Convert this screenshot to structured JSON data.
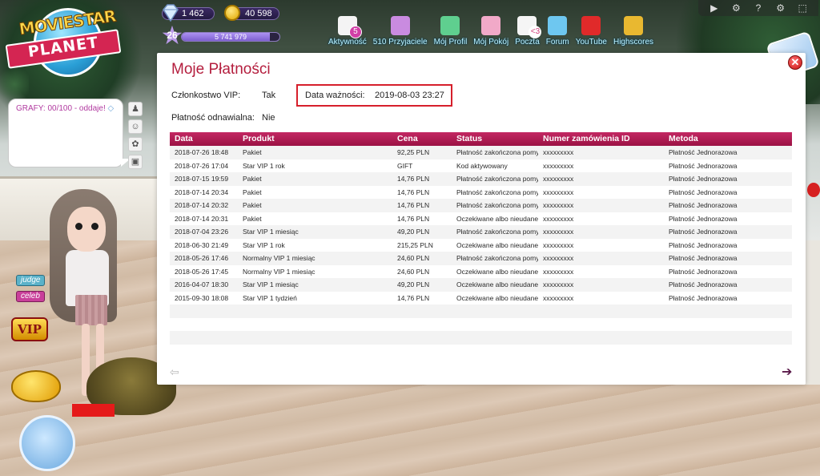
{
  "hud": {
    "diamonds": "1 462",
    "coins": "40 598",
    "level": "26",
    "xp": "5 741 979",
    "xp_progress": 0.9
  },
  "logo": {
    "line1": "MOVIESTAR",
    "line2": "PLANET"
  },
  "nav": [
    {
      "label": "Aktywność",
      "icon": "activity-icon",
      "color": "#f4f4f4",
      "badge": "5"
    },
    {
      "label": "510 Przyjaciele",
      "icon": "friends-icon",
      "color": "#c98be0"
    },
    {
      "label": "Mój Profil",
      "icon": "profile-icon",
      "color": "#5fcf8f"
    },
    {
      "label": "Mój Pokój",
      "icon": "room-icon",
      "color": "#f1a9c8"
    },
    {
      "label": "Poczta",
      "icon": "mail-icon",
      "color": "#f5f5f5",
      "badge_text": "<3"
    },
    {
      "label": "Forum",
      "icon": "forum-icon",
      "color": "#6ec7f0"
    },
    {
      "label": "YouTube",
      "icon": "youtube-icon",
      "color": "#e02a2a"
    },
    {
      "label": "Highscores",
      "icon": "trophy-icon",
      "color": "#e9b830"
    }
  ],
  "topright": [
    "▶",
    "⚙",
    "?",
    "⚙",
    "⬚"
  ],
  "chat": {
    "text": "GRAFY: 00/100 - oddaje!"
  },
  "tags": {
    "judge": "judge",
    "celeb": "celeb",
    "vip": "VIP"
  },
  "dialog": {
    "title": "Moje Płatności",
    "vip_label": "Członkostwo VIP:",
    "vip_value": "Tak",
    "expiry_label": "Data ważności:",
    "expiry_value": "2019-08-03 23:27",
    "renew_label": "Płatność odnawialna:",
    "renew_value": "Nie"
  },
  "table": {
    "headers": [
      "Data",
      "Produkt",
      "Cena",
      "Status",
      "Numer zamówienia ID",
      "Metoda"
    ],
    "rows": [
      [
        "2018-07-26 18:48",
        "Pakiet",
        "92,25 PLN",
        "Płatność zakończona pomyślnie",
        "xxxxxxxxx",
        "Płatność Jednorazowa"
      ],
      [
        "2018-07-26 17:04",
        "Star VIP 1 rok",
        "GIFT",
        "Kod aktywowany",
        "xxxxxxxxx",
        "Płatność Jednorazowa"
      ],
      [
        "2018-07-15 19:59",
        "Pakiet",
        "14,76 PLN",
        "Płatność zakończona pomyślnie",
        "xxxxxxxxx",
        "Płatność Jednorazowa"
      ],
      [
        "2018-07-14 20:34",
        "Pakiet",
        "14,76 PLN",
        "Płatność zakończona pomyślnie",
        "xxxxxxxxx",
        "Płatność Jednorazowa"
      ],
      [
        "2018-07-14 20:32",
        "Pakiet",
        "14,76 PLN",
        "Płatność zakończona pomyślnie",
        "xxxxxxxxx",
        "Płatność Jednorazowa"
      ],
      [
        "2018-07-14 20:31",
        "Pakiet",
        "14,76 PLN",
        "Oczekiwane albo nieudane",
        "xxxxxxxxx",
        "Płatność Jednorazowa"
      ],
      [
        "2018-07-04 23:26",
        "Star VIP 1 miesiąc",
        "49,20 PLN",
        "Płatność zakończona pomyślnie",
        "xxxxxxxxx",
        "Płatność Jednorazowa"
      ],
      [
        "2018-06-30 21:49",
        "Star VIP 1 rok",
        "215,25 PLN",
        "Oczekiwane albo nieudane",
        "xxxxxxxxx",
        "Płatność Jednorazowa"
      ],
      [
        "2018-05-26 17:46",
        "Normalny VIP 1 miesiąc",
        "24,60 PLN",
        "Płatność zakończona pomyślnie",
        "xxxxxxxxx",
        "Płatność Jednorazowa"
      ],
      [
        "2018-05-26 17:45",
        "Normalny VIP 1 miesiąc",
        "24,60 PLN",
        "Oczekiwane albo nieudane",
        "xxxxxxxxx",
        "Płatność Jednorazowa"
      ],
      [
        "2016-04-07 18:30",
        "Star VIP 1 miesiąc",
        "49,20 PLN",
        "Oczekiwane albo nieudane",
        "xxxxxxxxx",
        "Płatność Jednorazowa"
      ],
      [
        "2015-09-30 18:08",
        "Star VIP 1 tydzień",
        "14,76 PLN",
        "Oczekiwane albo nieudane",
        "xxxxxxxxx",
        "Płatność Jednorazowa"
      ]
    ],
    "empty_rows": 3
  },
  "pager": {
    "prev": "⇦",
    "next": "➔"
  },
  "colors": {
    "accent": "#b41e3e",
    "header": "#c32863",
    "highlight": "#d61f2b"
  }
}
